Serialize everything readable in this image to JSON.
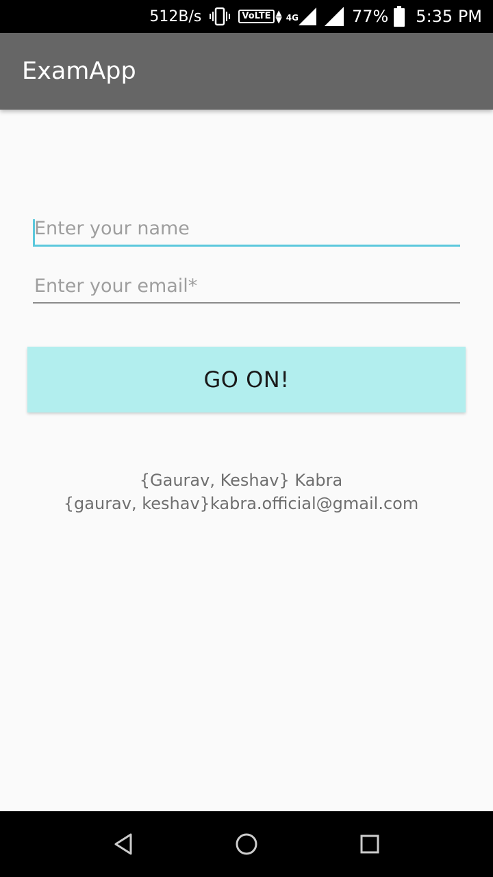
{
  "status_bar": {
    "net_speed": "512B/s",
    "volte": "VoLTE",
    "network_type": "4G",
    "battery_percent": "77%",
    "time": "5:35 PM"
  },
  "app_bar": {
    "title": "ExamApp"
  },
  "form": {
    "name_placeholder": "Enter your name",
    "name_value": "",
    "email_placeholder": "Enter your email*",
    "email_value": "",
    "submit_label": "GO ON!"
  },
  "credits": {
    "names": "{Gaurav, Keshav} Kabra",
    "email": "{gaurav, keshav}kabra.official@gmail.com"
  },
  "colors": {
    "app_bar": "#666666",
    "accent": "#5bc8dc",
    "button_bg": "#b2eeee",
    "background": "#fafafa"
  },
  "icons": {
    "vibrate": "vibrate-icon",
    "signal": "signal-icon",
    "battery": "battery-icon",
    "back": "back-icon",
    "home": "home-icon",
    "recents": "recents-icon"
  }
}
